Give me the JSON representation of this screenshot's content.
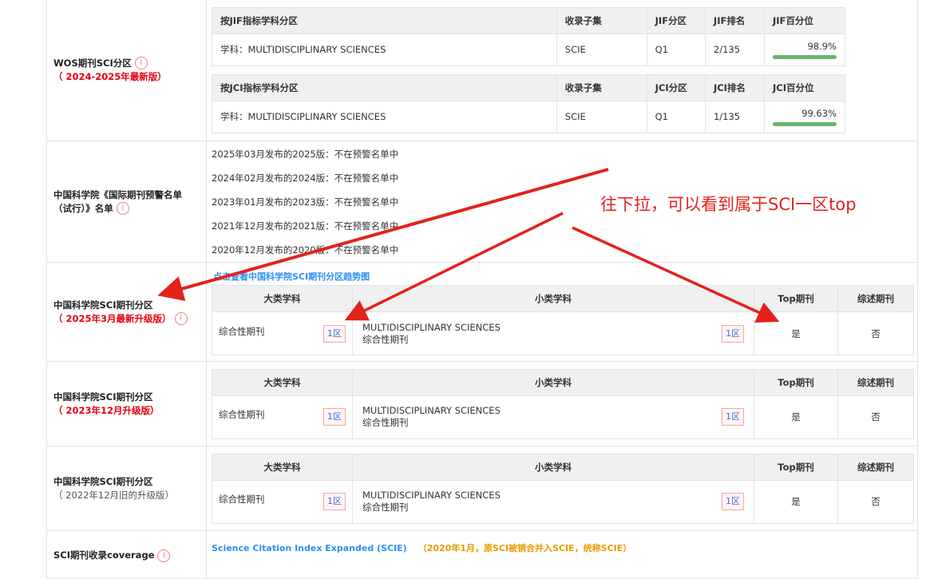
{
  "wos": {
    "label": "WOS期刊SCI分区",
    "sub": "（ 2024-2025年最新版）",
    "jif_header": [
      "按JIF指标学科分区",
      "收录子集",
      "JIF分区",
      "JIF排名",
      "JIF百分位"
    ],
    "jif_row": {
      "subject": "学科：MULTIDISCIPLINARY SCIENCES",
      "subset": "SCIE",
      "quartile": "Q1",
      "rank": "2/135",
      "pct": "98.9%",
      "pct_value": 98.9
    },
    "jci_header": [
      "按JCI指标学科分区",
      "收录子集",
      "JCI分区",
      "JCI排名",
      "JCI百分位"
    ],
    "jci_row": {
      "subject": "学科：MULTIDISCIPLINARY SCIENCES",
      "subset": "SCIE",
      "quartile": "Q1",
      "rank": "1/135",
      "pct": "99.63%",
      "pct_value": 99.63
    }
  },
  "warning": {
    "label": "中国科学院《国际期刊预警名单（试行）》名单",
    "items": [
      "2025年03月发布的2025版：不在预警名单中",
      "2024年02月发布的2024版：不在预警名单中",
      "2023年01月发布的2023版：不在预警名单中",
      "2021年12月发布的2021版：不在预警名单中",
      "2020年12月发布的2020版：不在预警名单中"
    ]
  },
  "cas_tables": [
    {
      "label": "中国科学院SCI期刊分区",
      "sub": "（ 2025年3月最新升级版）",
      "link": "点击查看中国科学院SCI期刊分区趋势图"
    },
    {
      "label": "中国科学院SCI期刊分区",
      "sub": "（ 2023年12月升级版）"
    },
    {
      "label": "中国科学院SCI期刊分区",
      "sub": "（ 2022年12月旧的升级版）"
    }
  ],
  "cas_header": {
    "major": "大类学科",
    "minor": "小类学科",
    "top": "Top期刊",
    "review": "综述期刊"
  },
  "cas_row": {
    "major": "综合性期刊",
    "zone": "1区",
    "minor_en": "MULTIDISCIPLINARY SCIENCES",
    "minor_cn": "综合性期刊",
    "top": "是",
    "review": "否"
  },
  "coverage": {
    "label": "SCI期刊收录coverage",
    "blue": "Science Citation Index Expanded (SCIE)",
    "orange": "（2020年1月，原SCI被销合并入SCIE，统称SCIE）"
  },
  "annotation": "往下拉，可以看到属于SCI一区top",
  "colors": {
    "accent_red": "#e3221c",
    "link_blue": "#2f8ff0",
    "bar_green": "#6ab56e"
  }
}
